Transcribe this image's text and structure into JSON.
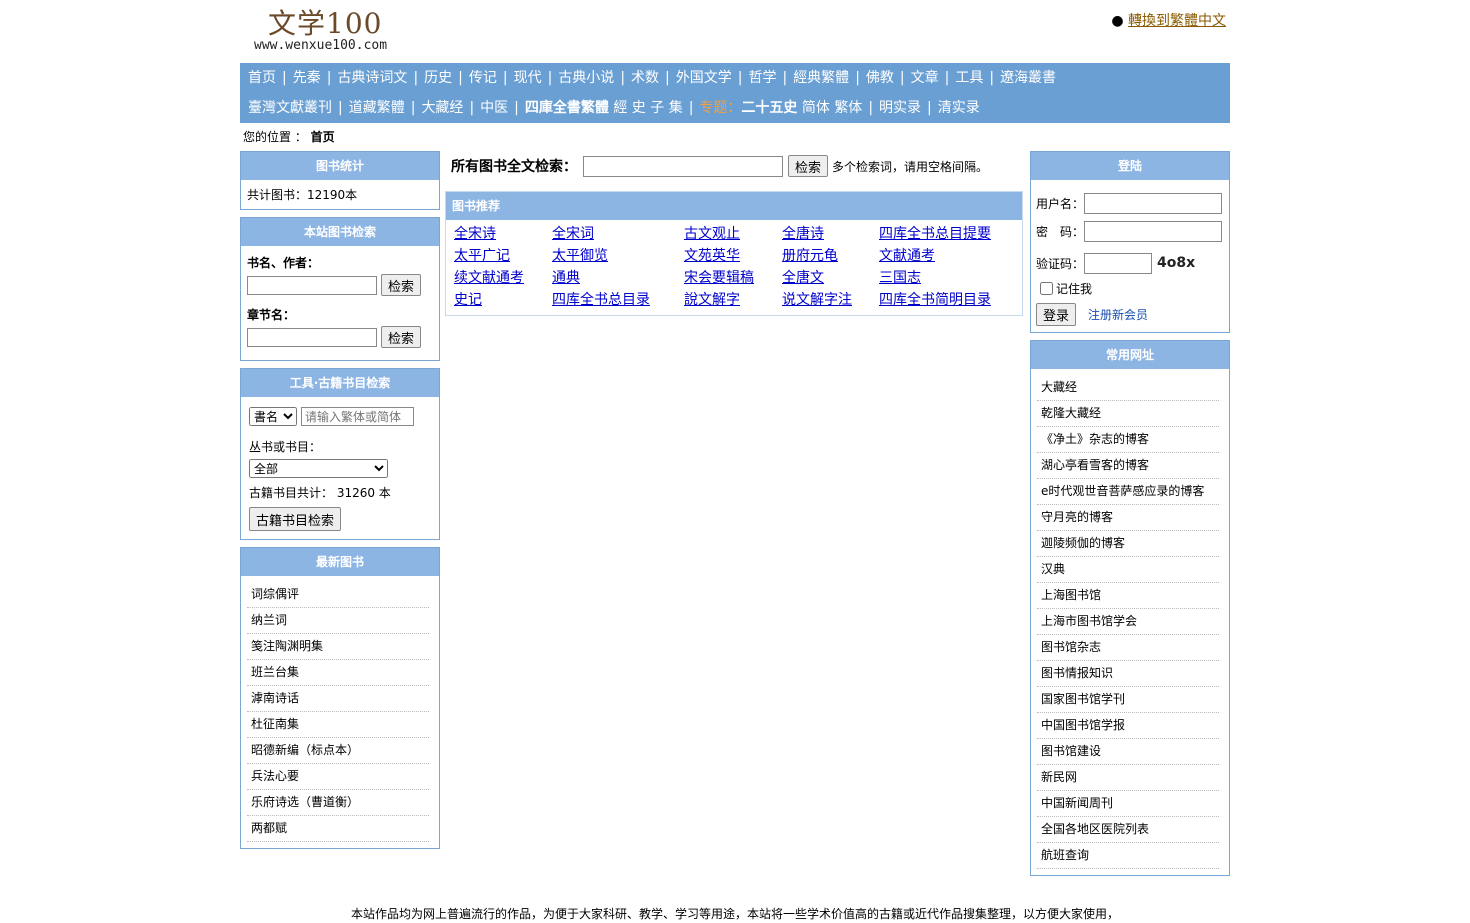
{
  "header": {
    "logo_title": "文学100",
    "logo_url_text": "www.wenxue100.com",
    "lang_bullet": "●",
    "lang_link": "轉換到繁體中文"
  },
  "nav": {
    "row1": [
      "首页",
      "先秦",
      "古典诗词文",
      "历史",
      "传记",
      "现代",
      "古典小说",
      "术数",
      "外国文学",
      "哲学",
      "經典繁體",
      "佛教",
      "文章",
      "工具",
      "遼海叢書"
    ],
    "row2": {
      "a": "臺灣文獻叢刊",
      "b": "道藏繁體",
      "c": "大藏经",
      "d": "中医",
      "siku": "四庫全書繁體",
      "jing": "經",
      "shi": "史",
      "zi": "子",
      "ji": "集",
      "zhuanti": "专题：",
      "ershiwu": "二十五史",
      "jianti": "简体",
      "fanti": "繁体",
      "mingshilu": "明实录",
      "qingshilu": "清实录",
      "sep": "|"
    }
  },
  "breadcrumb": {
    "label": "您的位置 ：",
    "current": "首页"
  },
  "stats": {
    "title": "图书统计",
    "text": "共计图书：12190本"
  },
  "site_search": {
    "title": "本站图书检索",
    "book_label": "书名、作者：",
    "chapter_label": "章节名：",
    "button": "检索"
  },
  "ancient_search": {
    "title": "工具·古籍书目检索",
    "select_value": "書名",
    "input_placeholder": "请输入繁体或简体",
    "series_label": "丛书或书目：",
    "series_value": "全部",
    "count_text": "古籍书目共计： 31260 本",
    "button": "古籍书目检索"
  },
  "latest": {
    "title": "最新图书",
    "items": [
      "词综偶评",
      "纳兰词",
      "笺注陶渊明集",
      "班兰台集",
      "滹南诗话",
      "杜征南集",
      "昭德新编（标点本）",
      "兵法心要",
      "乐府诗选（曹道衡）",
      "两都赋"
    ]
  },
  "fulltext": {
    "label": "所有图书全文检索：",
    "button": "检索",
    "hint": "多个检索词，请用空格间隔。"
  },
  "recommend": {
    "title": "图书推荐",
    "rows": [
      [
        "全宋诗",
        "全宋词",
        "古文观止",
        "全唐诗",
        "四库全书总目提要"
      ],
      [
        "太平广记",
        "太平御览",
        "文苑英华",
        "册府元龟",
        "文献通考"
      ],
      [
        "续文献通考",
        "通典",
        "宋会要辑稿",
        "全唐文",
        "三国志"
      ],
      [
        "史记",
        "四库全书总目录",
        "說文解字",
        "说文解字注",
        "四库全书简明目录"
      ]
    ]
  },
  "login": {
    "title": "登陆",
    "user_label": "用户名：",
    "pass_label": "密　码：",
    "captcha_label": "验证码：",
    "captcha_text": "4o8x",
    "remember": "记住我",
    "login_button": "登录",
    "register": "注册新会员"
  },
  "links": {
    "title": "常用网址",
    "items": [
      "大藏经",
      "乾隆大藏经",
      "《净土》杂志的博客",
      "湖心亭看雪客的博客",
      "e时代观世音菩萨感应录的博客",
      "守月亮的博客",
      "迦陵频伽的博客",
      "汉典",
      "上海图书馆",
      "上海市图书馆学会",
      "图书馆杂志",
      "图书情报知识",
      "国家图书馆学刊",
      "中国图书馆学报",
      "图书馆建设",
      "新民网",
      "中国新闻周刊",
      "全国各地区医院列表",
      "航班查询"
    ]
  },
  "footer": {
    "text": "本站作品均为网上普遍流行的作品，为便于大家科研、教学、学习等用途，本站将一些学术价值高的古籍或近代作品搜集整理，以方便大家使用，"
  }
}
